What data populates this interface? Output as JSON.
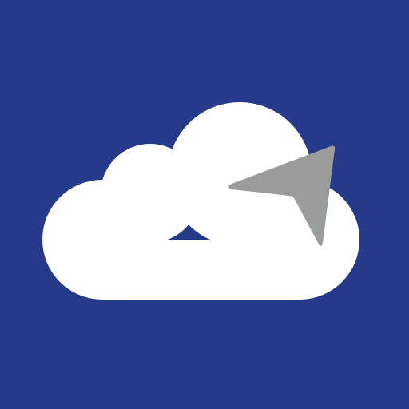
{
  "app_icon": {
    "icon": "cloud-navigation-arrow-icon",
    "colors": {
      "background": "#263a8a",
      "cloud": "#ffffff",
      "arrow": "#9b9d9d"
    }
  }
}
